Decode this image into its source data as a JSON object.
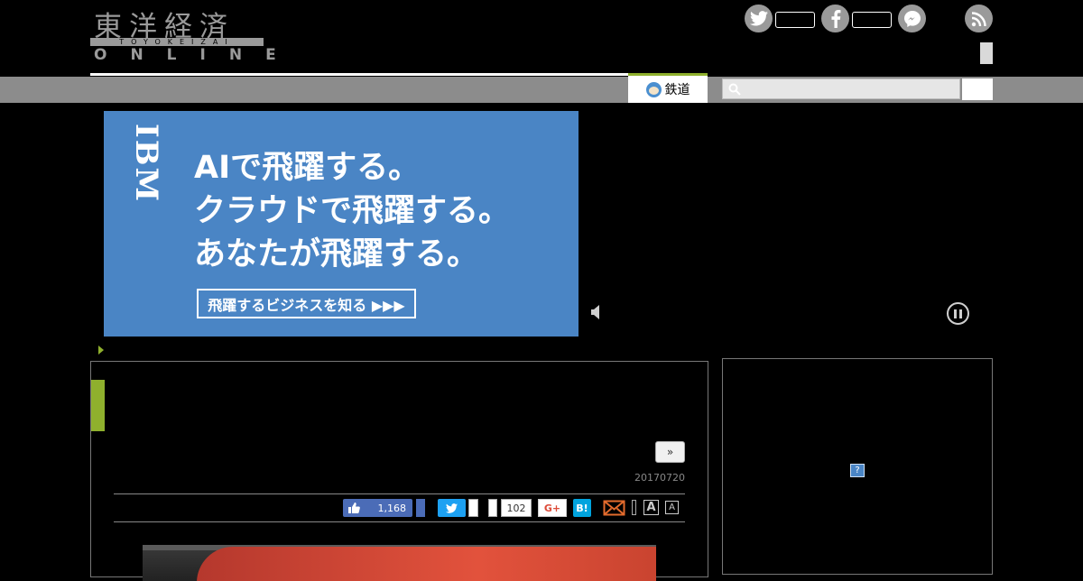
{
  "header": {
    "logo_kanji": "東洋経済",
    "logo_band": "TOYOKEIZAI",
    "logo_online": "ONLINE",
    "social_icons": [
      "twitter-icon",
      "facebook-icon",
      "messenger-icon",
      "rss-icon"
    ]
  },
  "nav": {
    "category_tab_label": "鉄道",
    "search": {
      "placeholder": "",
      "icon": "search-icon"
    }
  },
  "ad": {
    "brand": "IBM",
    "lines": [
      "AIで飛躍する。",
      "クラウドで飛躍する。",
      "あなたが飛躍する。"
    ],
    "cta": "飛躍するビジネスを知る ▶▶▶",
    "background_color": "#4a85c5"
  },
  "article": {
    "next_label": "»",
    "date": "20170720",
    "share": {
      "facebook_count": "1,168",
      "hatena_count": "102",
      "gplus_label": "G+",
      "hatena_label": "B!",
      "font_large": "A",
      "font_small": "A"
    }
  },
  "sidebar": {
    "adchoice_label": "?"
  },
  "colors": {
    "accent_green": "#8fb02d",
    "nav_gray": "#8c8c8c",
    "facebook_blue": "#4b6cb7",
    "twitter_blue": "#1da1f2"
  }
}
